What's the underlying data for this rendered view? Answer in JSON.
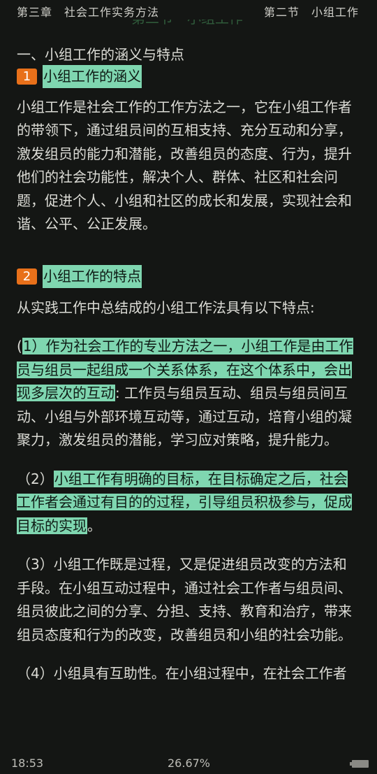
{
  "header": {
    "left": "第三章　社会工作实务方法",
    "right": "第二节　小组工作",
    "ghost_title": "第二节　小组工作"
  },
  "content": {
    "section_title": "一、小组工作的涵义与特点",
    "sub1": {
      "num": "1",
      "title": "小组工作的涵义"
    },
    "para1": "小组工作是社会工作的工作方法之一，它在小组工作者的带领下，通过组员间的互相支持、充分互动和分享，激发组员的能力和潜能，改善组员的态度、行为，提升他们的社会功能性，解决个人、群体、社区和社会问题，促进个人、小组和社区的成长和发展，实现社会和谐、公平、公正发展。",
    "sub2": {
      "num": "2",
      "title": "小组工作的特点"
    },
    "intro": "从实践工作中总结成的小组工作法具有以下特点:",
    "item1": {
      "prefix": "(",
      "highlight": "1）作为社会工作的专业方法之一，小组工作是由工作员与组员一起组成一个关系体系，在这个体系中，会出现多层次的互动",
      "rest": ": 工作员与组员互动、组员与组员间互动、小组与外部环境互动等，通过互动，培育小组的凝聚力，激发组员的潜能，学习应对策略，提升能力。"
    },
    "item2": {
      "prefix": "（2）",
      "highlight": "小组工作有明确的目标，在目标确定之后，社会工作者会通过有目的的过程，引导组员积极参与，促成目标的实现",
      "rest": "。"
    },
    "item3": "（3）小组工作既是过程，又是促进组员改变的方法和手段。在小组互动过程中，通过社会工作者与组员间、组员彼此之间的分享、分担、支持、教育和治疗，带来组员态度和行为的改变，改善组员和小组的社会功能。",
    "item4": "（4）小组具有互助性。在小组过程中，在社会工作者"
  },
  "status": {
    "time": "18:53",
    "progress": "26.67%"
  },
  "colors": {
    "background": "#141614",
    "highlight": "#7fd6b0",
    "badge": "#e8701a",
    "text": "#dcdcd6"
  }
}
